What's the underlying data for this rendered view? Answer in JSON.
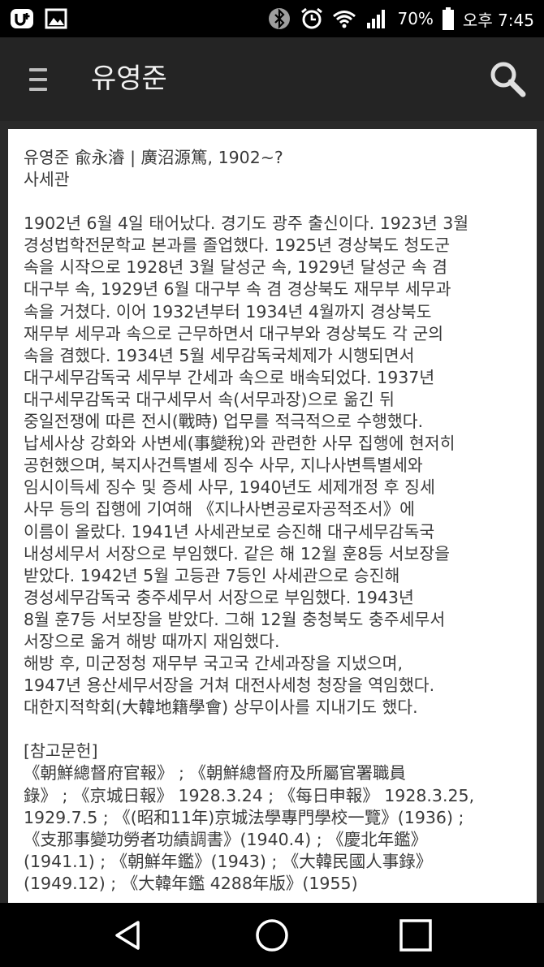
{
  "status_bar": {
    "battery_percent": "70%",
    "time": "오후 7:45",
    "icons": [
      "u-plus-icon",
      "image-icon",
      "bluetooth-icon",
      "alarm-icon",
      "wifi-icon",
      "signal-icon",
      "battery-icon"
    ]
  },
  "app_bar": {
    "title": "유영준"
  },
  "article": {
    "heading_line1": "유영준 兪永濬 | 廣沼源篤, 1902~?",
    "heading_line2": "사세관",
    "body_lines": [
      "1902년 6월 4일 태어났다. 경기도 광주 출신이다. 1923년 3월",
      "경성법학전문학교 본과를 졸업했다. 1925년 경상북도 청도군",
      "속을 시작으로 1928년 3월 달성군 속, 1929년 달성군 속 겸",
      "대구부 속, 1929년 6월 대구부 속 겸 경상북도 재무부 세무과",
      "속을 거쳤다. 이어 1932년부터 1934년 4월까지 경상북도",
      "재무부 세무과 속으로 근무하면서 대구부와 경상북도 각 군의",
      "속을 겸했다. 1934년 5월 세무감독국체제가 시행되면서",
      "대구세무감독국 세무부 간세과 속으로 배속되었다. 1937년",
      "대구세무감독국 대구세무서 속(서무과장)으로 옮긴 뒤",
      "중일전쟁에 따른 전시(戰時) 업무를 적극적으로 수행했다.",
      "납세사상 강화와 사변세(事變稅)와 관련한 사무 집행에 현저히",
      "공헌했으며, 북지사건특별세 징수 사무, 지나사변특별세와",
      "임시이득세 징수 및 증세 사무, 1940년도 세제개정 후 징세",
      "사무 등의 집행에 기여해 《지나사변공로자공적조서》에",
      "이름이 올랐다. 1941년 사세관보로 승진해 대구세무감독국",
      "내성세무서 서장으로 부임했다. 같은 해 12월 훈8등 서보장을",
      "받았다. 1942년 5월 고등관 7등인 사세관으로 승진해",
      "경성세무감독국 충주세무서 서장으로 부임했다. 1943년",
      "8월 훈7등 서보장을 받았다. 그해 12월 충청북도 충주세무서",
      "서장으로 옮겨 해방 때까지 재임했다.",
      "해방 후, 미군정청 재무부 국고국 간세과장을 지냈으며,",
      "1947년 용산세무서장을 거쳐 대전사세청 청장을 역임했다.",
      "대한지적학회(大韓地籍學會) 상무이사를 지내기도 했다."
    ],
    "references_title": "[참고문헌]",
    "reference_lines": [
      "《朝鮮總督府官報》 ; 《朝鮮總督府及所屬官署職員",
      "錄》 ; 《京城日報》 1928.3.24 ; 《每日申報》 1928.3.25,",
      "1929.7.5 ; 《(昭和11年)京城法學專門學校一覽》(1936) ;",
      "《支那事變功勞者功績調書》(1940.4) ; 《慶北年鑑》",
      "(1941.1) ; 《朝鮮年鑑》(1943) ; 《大韓民國人事錄》",
      "(1949.12) ; 《大韓年鑑 4288年版》(1955)"
    ]
  },
  "nav_bar": {
    "buttons": [
      "back-icon",
      "home-icon",
      "recents-icon"
    ]
  }
}
